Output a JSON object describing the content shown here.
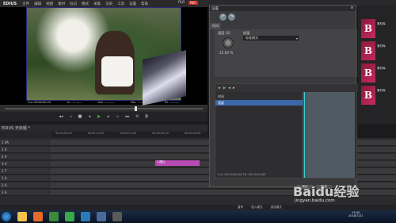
{
  "menubar": {
    "logo": "EDIUS",
    "items": [
      "文件",
      "编辑",
      "视图",
      "素材",
      "标记",
      "模式",
      "采集",
      "渲染",
      "工具",
      "设置",
      "帮助"
    ],
    "player_mode": "PLR",
    "rec_mode": "REC"
  },
  "player": {
    "tc_in": "Cur 00:00:00;10",
    "tc_mark_in": "In --:--:--;--",
    "tc_mark_out": "Out --:--:--;--",
    "tc_dur": "Dur --:--:--;--",
    "tc_ttl": "Ttl --:--:--;--"
  },
  "transport": [
    "◂◂",
    "◃",
    "■",
    "◂",
    "▶",
    "▸",
    "▹",
    "▸▸",
    "⟲",
    "⧉"
  ],
  "timeline": {
    "title": "EDIUS 无标题 *",
    "sequence_tab": "序列1",
    "tracks": [
      {
        "name": "1 VA",
        "type": "VA"
      },
      {
        "name": "1 V",
        "type": "V"
      },
      {
        "name": "2 V",
        "type": "V"
      },
      {
        "name": "3 V",
        "type": "V"
      },
      {
        "name": "1 T",
        "type": "T"
      },
      {
        "name": "1 A",
        "type": "A"
      },
      {
        "name": "2 A",
        "type": "A"
      },
      {
        "name": "3 A",
        "type": "A"
      }
    ],
    "pink_clip_label": "1.图片",
    "ruler_marks": [
      "00:00:00;00",
      "00:00:10;00",
      "00:00:20;00",
      "00:00:30;00",
      "00:00:40;00"
    ]
  },
  "dialog": {
    "title": "设置",
    "close_label": "×",
    "tab_time": "时间",
    "speed_label": "速度 (S)",
    "speed_value": "25.00 %",
    "select_label": "插值",
    "select_value": "标准模式",
    "kf_rows": [
      {
        "label": "时间",
        "selected": false
      },
      {
        "label": "速度",
        "selected": true
      }
    ],
    "status_cur": "Cur: 00:00:00;00",
    "status_ttl": "Ttl: 00:00:05;00",
    "ok_label": "确定",
    "cancel_label": "取消"
  },
  "bin": {
    "items": [
      {
        "glyph": "B",
        "text": "素材库"
      },
      {
        "glyph": "B",
        "text": "素材库"
      },
      {
        "glyph": "B",
        "text": "素材库"
      },
      {
        "glyph": "B",
        "text": "素材库"
      }
    ]
  },
  "statusbar": {
    "left": "暂停",
    "mid": "插入模式",
    "right": "波纹模式"
  },
  "taskbar": {
    "time": "15:00",
    "date": "2018/7/21"
  },
  "watermark": {
    "main": "Baidu经验",
    "sub": "jingyan.baidu.com"
  },
  "colors": {
    "accent_pink": "#b84bb3",
    "rec_red": "#d0291e",
    "selection_blue": "#3a68a8",
    "keyframe_cyan": "#3fd0d0"
  }
}
